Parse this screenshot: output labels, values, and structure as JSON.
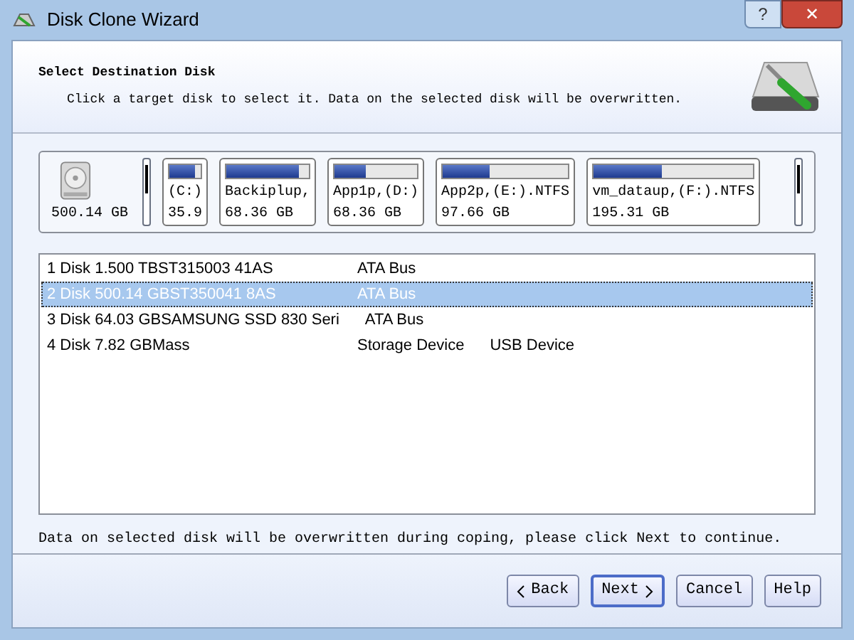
{
  "window": {
    "title": "Disk Clone Wizard",
    "controls": [
      {
        "label": "?",
        "kind": "help"
      },
      {
        "label": "✕",
        "kind": "close"
      }
    ]
  },
  "header": {
    "title": "Select Destination Disk",
    "subtitle": "Click a target disk to select it. Data on the selected disk will be overwritten."
  },
  "disk_map": {
    "capacity": "500.14 GB",
    "partitions": [
      {
        "label": "(C:)",
        "size": "35.9",
        "level": 0.8
      },
      {
        "label": "Backiplup,",
        "size": "68.36 GB",
        "level": 0.88
      },
      {
        "label": "App1p,(D:)",
        "size": "68.36 GB",
        "level": 0.38
      },
      {
        "label": "App2p,(E:).NTFS",
        "size": "97.66 GB",
        "level": 0.38
      },
      {
        "label": "vm_dataup,(F:).NTFS",
        "size": "195.31 GB",
        "level": 0.43
      }
    ]
  },
  "disks": [
    {
      "parts": [
        "1 Disk 1.500 TBST315003 41AS",
        "ATA Bus"
      ],
      "selected": false
    },
    {
      "parts": [
        "2 Disk 500.14 GBST350041 8AS",
        "ATA Bus"
      ],
      "selected": true
    },
    {
      "parts": [
        "3 Disk 64.03 GBSAMSUNG  SSD 830 Seri",
        "ATA Bus"
      ],
      "selected": false
    },
    {
      "parts": [
        "4 Disk 7.82 GBMass",
        "Storage Device",
        "USB Device"
      ],
      "selected": false
    }
  ],
  "note": "Data on selected disk will be overwritten during coping, please click Next to continue.",
  "buttons": [
    {
      "label": "Back",
      "kind": "back",
      "default": false
    },
    {
      "label": "Next",
      "kind": "next",
      "default": true
    },
    {
      "label": "Cancel",
      "kind": "plain",
      "default": false
    },
    {
      "label": "Help",
      "kind": "plain",
      "default": false
    }
  ]
}
